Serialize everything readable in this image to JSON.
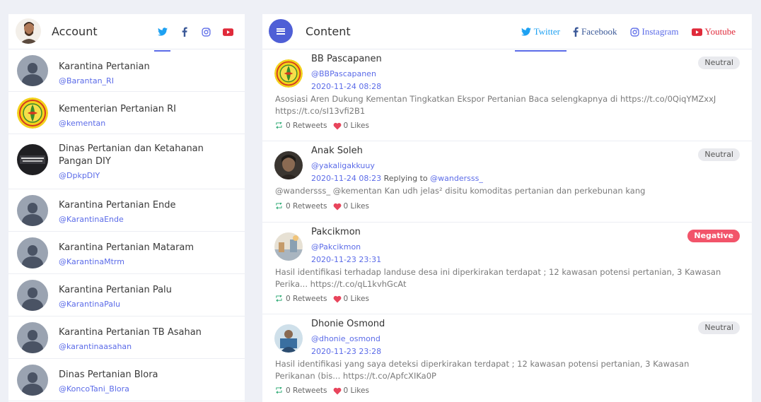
{
  "account": {
    "title": "Account",
    "items": [
      {
        "name": "Karantina Pertanian",
        "handle": "@Barantan_RI",
        "avatar": "placeholder"
      },
      {
        "name": "Kementerian Pertanian RI",
        "handle": "@kementan",
        "avatar": "kementan-logo"
      },
      {
        "name": "Dinas Pertanian dan Ketahanan Pangan DIY",
        "handle": "@DpkpDIY",
        "avatar": "photo"
      },
      {
        "name": "Karantina Pertanian Ende",
        "handle": "@KarantinaEnde",
        "avatar": "placeholder"
      },
      {
        "name": "Karantina Pertanian Mataram",
        "handle": "@KarantinaMtrm",
        "avatar": "placeholder"
      },
      {
        "name": "Karantina Pertanian Palu",
        "handle": "@KarantinaPalu",
        "avatar": "placeholder"
      },
      {
        "name": "Karantina Pertanian TB Asahan",
        "handle": "@karantinaasahan",
        "avatar": "placeholder"
      },
      {
        "name": "Dinas Pertanian Blora",
        "handle": "@KoncoTani_Blora",
        "avatar": "placeholder"
      }
    ]
  },
  "content": {
    "title": "Content",
    "tabs": [
      {
        "label": "Twitter",
        "icon": "twitter-icon",
        "color": "#1da1f2"
      },
      {
        "label": "Facebook",
        "icon": "facebook-icon",
        "color": "#3b5998"
      },
      {
        "label": "Instagram",
        "icon": "instagram-icon",
        "color": "#5b6be8"
      },
      {
        "label": "Youtube",
        "icon": "youtube-icon",
        "color": "#e02a3a"
      }
    ],
    "posts": [
      {
        "name": "BB Pascapanen",
        "handle": "@BBPascapanen",
        "date": "2020-11-24 08:28",
        "reply_label": "",
        "reply_to": "",
        "text": "Asosiasi Aren Dukung Kementan Tingkatkan Ekspor Pertanian Baca selengkapnya di https://t.co/0QiqYMZxxJ https://t.co/sI13vfi2B1",
        "retweets": "0 Retweets",
        "likes": "0 Likes",
        "sentiment": "Neutral"
      },
      {
        "name": "Anak Soleh",
        "handle": "@yakaligakkuuy",
        "date": "2020-11-24 08:23",
        "reply_label": "Replying to",
        "reply_to": "@wandersss_",
        "text": "@wandersss_ @kementan Kan udh jelas² disitu komoditas pertanian dan perkebunan kang",
        "retweets": "0 Retweets",
        "likes": "0 Likes",
        "sentiment": "Neutral"
      },
      {
        "name": "Pakcikmon",
        "handle": "@Pakcikmon",
        "date": "2020-11-23 23:31",
        "reply_label": "",
        "reply_to": "",
        "text": "Hasil identifikasi terhadap landuse desa ini diperkirakan terdapat ; 12 kawasan potensi pertanian, 3 Kawasan Perika... https://t.co/qL1kvhGcAt",
        "retweets": "0 Retweets",
        "likes": "0 Likes",
        "sentiment": "Negative"
      },
      {
        "name": "Dhonie Osmond",
        "handle": "@dhonie_osmond",
        "date": "2020-11-23 23:28",
        "reply_label": "",
        "reply_to": "",
        "text": "Hasil identifikasi yang saya deteksi diperkirakan terdapat ; 12 kawasan potensi pertanian, 3 Kawasan Perikanan (bis... https://t.co/ApfcXIKa0P",
        "retweets": "0 Retweets",
        "likes": "0 Likes",
        "sentiment": "Neutral"
      }
    ]
  },
  "colors": {
    "accent": "#5b6be8",
    "menu": "#4f5fd6",
    "negative": "#f2546a",
    "like": "#e8455c",
    "retweet": "#20a56b"
  }
}
